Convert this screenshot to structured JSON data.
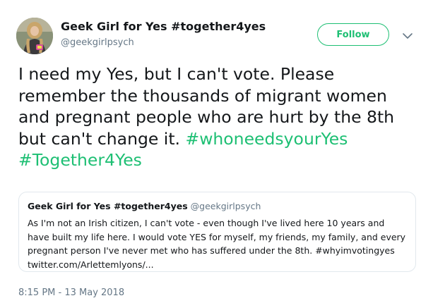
{
  "author": {
    "display_name": "Geek Girl for Yes #together4yes",
    "handle": "@geekgirlpsych"
  },
  "follow_button": {
    "label": "Follow"
  },
  "tweet": {
    "text_part1": "I need my Yes, but I can't vote. Please remember the thousands of migrant women and pregnant people who are hurt by the 8th but can't change it. ",
    "hashtag1": "#whoneedsyourYes",
    "hashtag2": "#Together4Yes"
  },
  "quoted_tweet": {
    "display_name": "Geek Girl for Yes #together4yes",
    "handle": "@geekgirlpsych",
    "text": "As I'm not an Irish citizen, I can't vote - even though I've lived here 10 years and have built my life here. I would vote YES for myself, my friends, my family, and every pregnant person I've never met who has suffered under the 8th. #whyimvotingyes twitter.com/Arlettemlyons/..."
  },
  "timestamp": "8:15 PM - 13 May 2018",
  "colors": {
    "accent": "#1dbf73",
    "secondary_text": "#657786",
    "border": "#e1e8ed"
  },
  "icons": {
    "caret": "chevron-down-icon",
    "avatar": "profile-photo"
  }
}
